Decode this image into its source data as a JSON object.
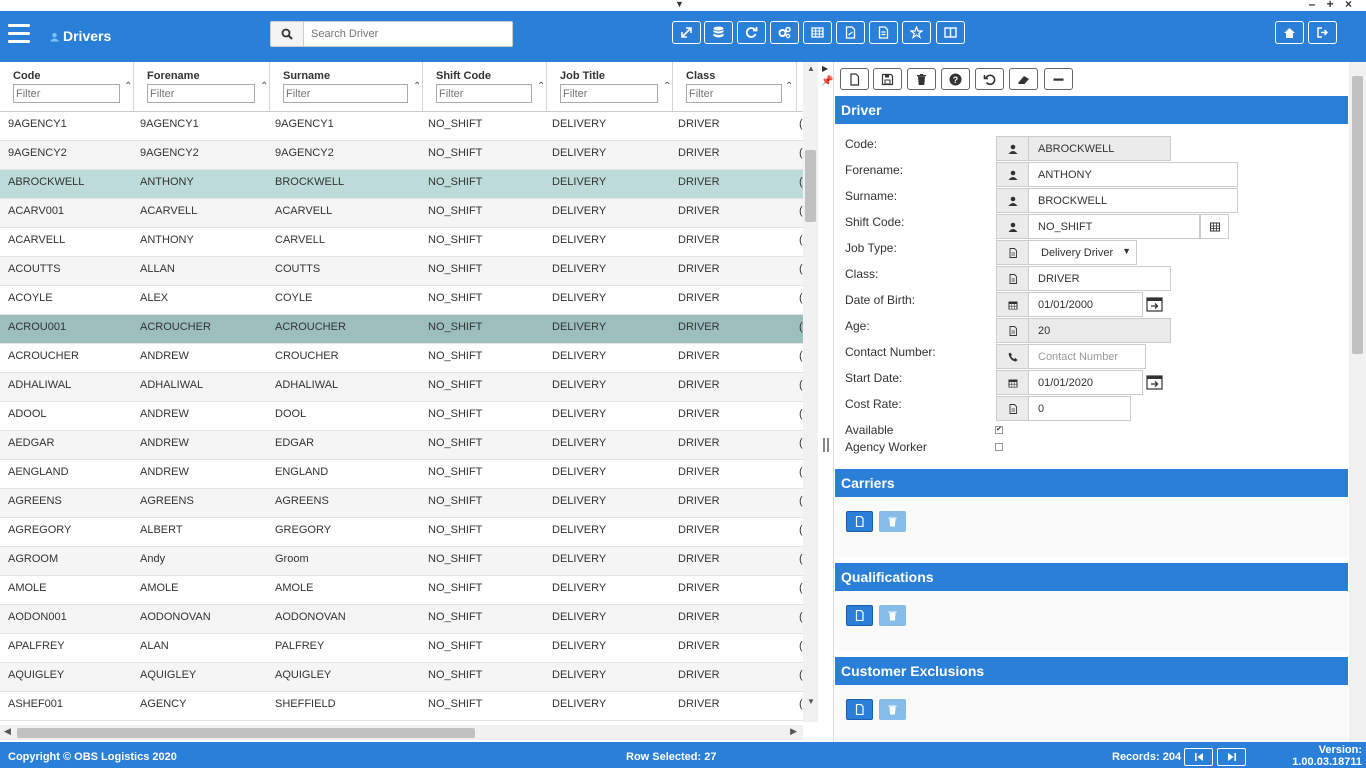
{
  "window": {
    "collapse_arrow": "▼",
    "controls": "– + ×"
  },
  "header": {
    "title": "Drivers",
    "search_placeholder": "Search Driver",
    "toolbar_icons": [
      "expand-icon",
      "database-icon",
      "refresh-icon",
      "cogs-icon",
      "table-icon",
      "export-pdf-icon",
      "export-file-icon",
      "star-icon",
      "columns-icon"
    ],
    "right_icons": [
      "home-icon",
      "logout-icon"
    ]
  },
  "grid": {
    "columns": [
      {
        "label": "Code",
        "placeholder": "Filter"
      },
      {
        "label": "Forename",
        "placeholder": "Filter"
      },
      {
        "label": "Surname",
        "placeholder": "Filter"
      },
      {
        "label": "Shift Code",
        "placeholder": "Filter"
      },
      {
        "label": "Job Title",
        "placeholder": "Filter"
      },
      {
        "label": "Class",
        "placeholder": "Filter"
      }
    ],
    "rows": [
      [
        "9AGENCY1",
        "9AGENCY1",
        "9AGENCY1",
        "NO_SHIFT",
        "DELIVERY",
        "DRIVER"
      ],
      [
        "9AGENCY2",
        "9AGENCY2",
        "9AGENCY2",
        "NO_SHIFT",
        "DELIVERY",
        "DRIVER"
      ],
      [
        "ABROCKWELL",
        "ANTHONY",
        "BROCKWELL",
        "NO_SHIFT",
        "DELIVERY",
        "DRIVER"
      ],
      [
        "ACARV001",
        "ACARVELL",
        "ACARVELL",
        "NO_SHIFT",
        "DELIVERY",
        "DRIVER"
      ],
      [
        "ACARVELL",
        "ANTHONY",
        "CARVELL",
        "NO_SHIFT",
        "DELIVERY",
        "DRIVER"
      ],
      [
        "ACOUTTS",
        "ALLAN",
        "COUTTS",
        "NO_SHIFT",
        "DELIVERY",
        "DRIVER"
      ],
      [
        "ACOYLE",
        "ALEX",
        "COYLE",
        "NO_SHIFT",
        "DELIVERY",
        "DRIVER"
      ],
      [
        "ACROU001",
        "ACROUCHER",
        "ACROUCHER",
        "NO_SHIFT",
        "DELIVERY",
        "DRIVER"
      ],
      [
        "ACROUCHER",
        "ANDREW",
        "CROUCHER",
        "NO_SHIFT",
        "DELIVERY",
        "DRIVER"
      ],
      [
        "ADHALIWAL",
        "ADHALIWAL",
        "ADHALIWAL",
        "NO_SHIFT",
        "DELIVERY",
        "DRIVER"
      ],
      [
        "ADOOL",
        "ANDREW",
        "DOOL",
        "NO_SHIFT",
        "DELIVERY",
        "DRIVER"
      ],
      [
        "AEDGAR",
        "ANDREW",
        "EDGAR",
        "NO_SHIFT",
        "DELIVERY",
        "DRIVER"
      ],
      [
        "AENGLAND",
        "ANDREW",
        "ENGLAND",
        "NO_SHIFT",
        "DELIVERY",
        "DRIVER"
      ],
      [
        "AGREENS",
        "AGREENS",
        "AGREENS",
        "NO_SHIFT",
        "DELIVERY",
        "DRIVER"
      ],
      [
        "AGREGORY",
        "ALBERT",
        "GREGORY",
        "NO_SHIFT",
        "DELIVERY",
        "DRIVER"
      ],
      [
        "AGROOM",
        "Andy",
        "Groom",
        "NO_SHIFT",
        "DELIVERY",
        "DRIVER"
      ],
      [
        "AMOLE",
        "AMOLE",
        "AMOLE",
        "NO_SHIFT",
        "DELIVERY",
        "DRIVER"
      ],
      [
        "AODON001",
        "AODONOVAN",
        "AODONOVAN",
        "NO_SHIFT",
        "DELIVERY",
        "DRIVER"
      ],
      [
        "APALFREY",
        "ALAN",
        "PALFREY",
        "NO_SHIFT",
        "DELIVERY",
        "DRIVER"
      ],
      [
        "AQUIGLEY",
        "AQUIGLEY",
        "AQUIGLEY",
        "NO_SHIFT",
        "DELIVERY",
        "DRIVER"
      ],
      [
        "ASHEF001",
        "AGENCY",
        "SHEFFIELD",
        "NO_SHIFT",
        "DELIVERY",
        "DRIVER"
      ]
    ],
    "highlight_rows": [
      2,
      7
    ],
    "colors": {
      "row_selected": "#bcdbd9",
      "row_active": "#9cbfbe",
      "accent": "#2a7fd8"
    }
  },
  "detail": {
    "toolbar_icons": [
      "new-icon",
      "save-icon",
      "delete-icon",
      "help-icon",
      "undo-icon",
      "eraser-icon",
      "minimize-icon"
    ],
    "section_title": "Driver",
    "fields": {
      "code": {
        "label": "Code:",
        "value": "ABROCKWELL"
      },
      "forename": {
        "label": "Forename:",
        "value": "ANTHONY"
      },
      "surname": {
        "label": "Surname:",
        "value": "BROCKWELL"
      },
      "shift_code": {
        "label": "Shift Code:",
        "value": "NO_SHIFT"
      },
      "job_type": {
        "label": "Job Type:",
        "value": "Delivery Driver"
      },
      "class": {
        "label": "Class:",
        "value": "DRIVER"
      },
      "dob": {
        "label": "Date of Birth:",
        "value": "01/01/2000"
      },
      "age": {
        "label": "Age:",
        "value": "20"
      },
      "contact": {
        "label": "Contact Number:",
        "value": "",
        "placeholder": "Contact Number"
      },
      "start_date": {
        "label": "Start Date:",
        "value": "01/01/2020"
      },
      "cost_rate": {
        "label": "Cost Rate:",
        "value": "0"
      },
      "available": {
        "label": "Available",
        "checked": true
      },
      "agency": {
        "label": "Agency Worker",
        "checked": false
      }
    },
    "sections": [
      "Carriers",
      "Qualifications",
      "Customer Exclusions"
    ]
  },
  "footer": {
    "copyright": "Copyright © OBS Logistics 2020",
    "row_selected": "Row Selected: 27",
    "records": "Records: 204",
    "version_label": "Version:",
    "version": "1.00.03.18711"
  }
}
